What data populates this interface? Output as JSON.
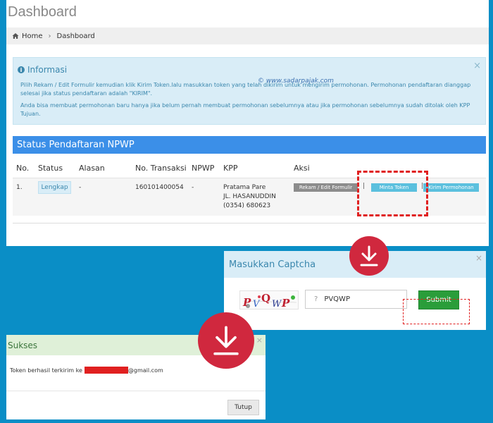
{
  "dashboard": {
    "title": "Dashboard",
    "breadcrumb": {
      "home": "Home",
      "current": "Dashboard"
    },
    "info": {
      "title": "Informasi",
      "close": "×",
      "paragraph1": "Pilih Rekam / Edit Formulir kemudian klik Kirim Token.lalu masukkan token yang telah dikirim untuk mengirim permohonan. Permohonan pendaftaran dianggap selesai jika status pendaftaran adalah \"KIRIM\".",
      "paragraph2": "Anda bisa membuat permohonan baru hanya jika belum pernah membuat permohonan sebelumnya atau jika permohonan sebelumnya sudah ditolak oleh KPP Tujuan."
    },
    "watermark": "© www.sadarpajak.com",
    "status_section": {
      "title": "Status Pendaftaran NPWP",
      "headers": [
        "No.",
        "Status",
        "Alasan",
        "No. Transaksi",
        "NPWP",
        "KPP",
        "Aksi"
      ],
      "row": {
        "no": "1.",
        "status": "Lengkap",
        "alasan": "-",
        "transaksi": "160101400054",
        "npwp": "-",
        "kpp_line1": "Pratama Pare",
        "kpp_line2": "JL. HASANUDDIN",
        "kpp_line3": "(0354) 680623",
        "actions": [
          "Rekam / Edit Formulir",
          "Minta Token",
          "Kirim Permohonan"
        ],
        "separator": "|"
      }
    }
  },
  "captcha_dialog": {
    "title": "Masukkan Captcha",
    "close": "×",
    "captcha_letters": [
      "P",
      "V",
      "Q",
      "W",
      "P"
    ],
    "input_hint": "?",
    "input_value": "PVQWP",
    "submit_label": "Submit"
  },
  "sukses_dialog": {
    "title": "Sukses",
    "close": "×",
    "message_prefix": "Token berhasil terkirim ke",
    "message_suffix": "@gmail.com",
    "close_button": "Tutup"
  },
  "colors": {
    "background": "#0a8ec6",
    "status_header": "#3b8fe8",
    "info_bg": "#d9edf7",
    "success_bg": "#dff0d8",
    "submit": "#2a9d3a",
    "highlight": "#e02020",
    "arrow_circle": "#d0283e"
  },
  "icons": [
    "home-icon",
    "info-icon",
    "download-arrow-icon",
    "close-icon"
  ]
}
